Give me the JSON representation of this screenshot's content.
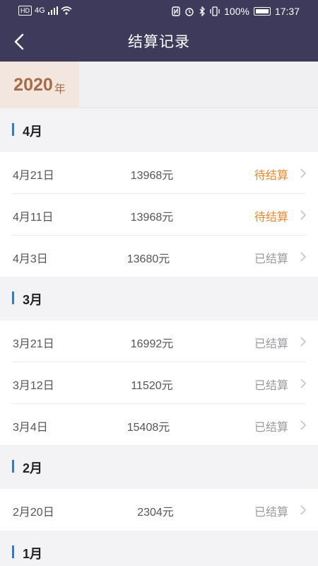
{
  "status_bar": {
    "hd": "HD",
    "net": "4G",
    "battery": "100%",
    "time": "17:37"
  },
  "header": {
    "title": "结算记录"
  },
  "year": {
    "number": "2020",
    "unit": "年"
  },
  "months": [
    {
      "label": "4月",
      "rows": [
        {
          "date": "4月21日",
          "amount": "13968元",
          "status": "待结算"
        },
        {
          "date": "4月11日",
          "amount": "13968元",
          "status": "待结算"
        },
        {
          "date": "4月3日",
          "amount": "13680元",
          "status": "已结算"
        }
      ]
    },
    {
      "label": "3月",
      "rows": [
        {
          "date": "3月21日",
          "amount": "16992元",
          "status": "已结算"
        },
        {
          "date": "3月12日",
          "amount": "11520元",
          "status": "已结算"
        },
        {
          "date": "3月4日",
          "amount": "15408元",
          "status": "已结算"
        }
      ]
    },
    {
      "label": "2月",
      "rows": [
        {
          "date": "2月20日",
          "amount": "2304元",
          "status": "已结算"
        }
      ]
    },
    {
      "label": "1月",
      "rows": []
    }
  ],
  "colors": {
    "header_bg": "#3e3a5c",
    "pending": "#e8892e",
    "settled": "#999aa0",
    "accent": "#2f7bdc",
    "year": "#a76b45"
  }
}
